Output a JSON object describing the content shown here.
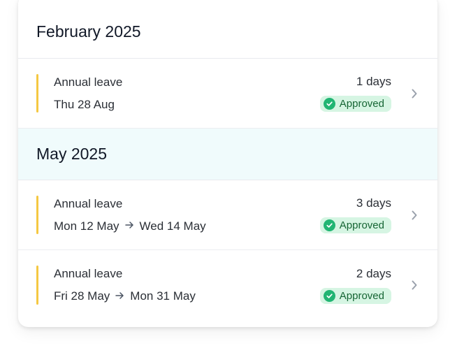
{
  "sections": [
    {
      "heading": "February 2025",
      "items": [
        {
          "title": "Annual leave",
          "start": "Thu 28 Aug",
          "end": "",
          "duration": "1 days",
          "status": "Approved"
        }
      ]
    },
    {
      "heading": "May 2025",
      "items": [
        {
          "title": "Annual leave",
          "start": "Mon 12 May",
          "end": "Wed 14 May",
          "duration": "3 days",
          "status": "Approved"
        },
        {
          "title": "Annual leave",
          "start": "Fri 28 May",
          "end": "Mon 31 May",
          "duration": "2 days",
          "status": "Approved"
        }
      ]
    }
  ],
  "icons": {
    "arrow": "arrow-right-icon",
    "check": "check-circle-icon",
    "chevron": "chevron-right-icon"
  },
  "colors": {
    "accent_bar": "#f5c842",
    "badge_bg": "#d6f5e3",
    "badge_check": "#21b573",
    "highlight_header": "#f0fbfc"
  }
}
